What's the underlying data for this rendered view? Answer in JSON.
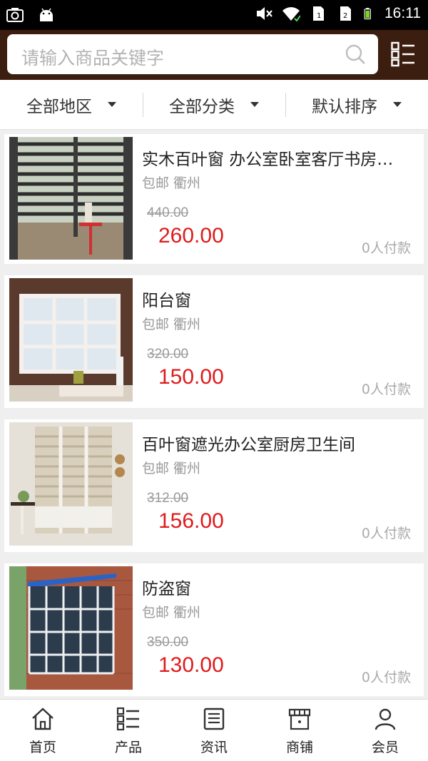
{
  "status_bar": {
    "time": "16:11",
    "icons": [
      "screenshot-icon",
      "android-icon",
      "mute-icon",
      "wifi-icon",
      "sim1-icon",
      "sim2-icon",
      "battery-icon"
    ]
  },
  "search": {
    "placeholder": "请输入商品关键字",
    "icon": "search-icon",
    "menu_icon": "grid-list-icon"
  },
  "filters": [
    {
      "label": "全部地区"
    },
    {
      "label": "全部分类"
    },
    {
      "label": "默认排序"
    }
  ],
  "products": [
    {
      "title": "实木百叶窗 办公室卧室客厅书房…",
      "meta": "包邮 衢州",
      "old_price": "440.00",
      "price": "260.00",
      "sold": "0人付款"
    },
    {
      "title": "阳台窗",
      "meta": "包邮 衢州",
      "old_price": "320.00",
      "price": "150.00",
      "sold": "0人付款"
    },
    {
      "title": "百叶窗遮光办公室厨房卫生间",
      "meta": "包邮 衢州",
      "old_price": "312.00",
      "price": "156.00",
      "sold": "0人付款"
    },
    {
      "title": "防盗窗",
      "meta": "包邮 衢州",
      "old_price": "350.00",
      "price": "130.00",
      "sold": "0人付款"
    }
  ],
  "tabbar": [
    {
      "label": "首页",
      "icon": "home-icon"
    },
    {
      "label": "产品",
      "icon": "product-grid-icon"
    },
    {
      "label": "资讯",
      "icon": "news-icon"
    },
    {
      "label": "商铺",
      "icon": "store-icon"
    },
    {
      "label": "会员",
      "icon": "member-icon"
    }
  ],
  "colors": {
    "header_bg": "#3b1e0f",
    "price": "#e01b1b"
  }
}
